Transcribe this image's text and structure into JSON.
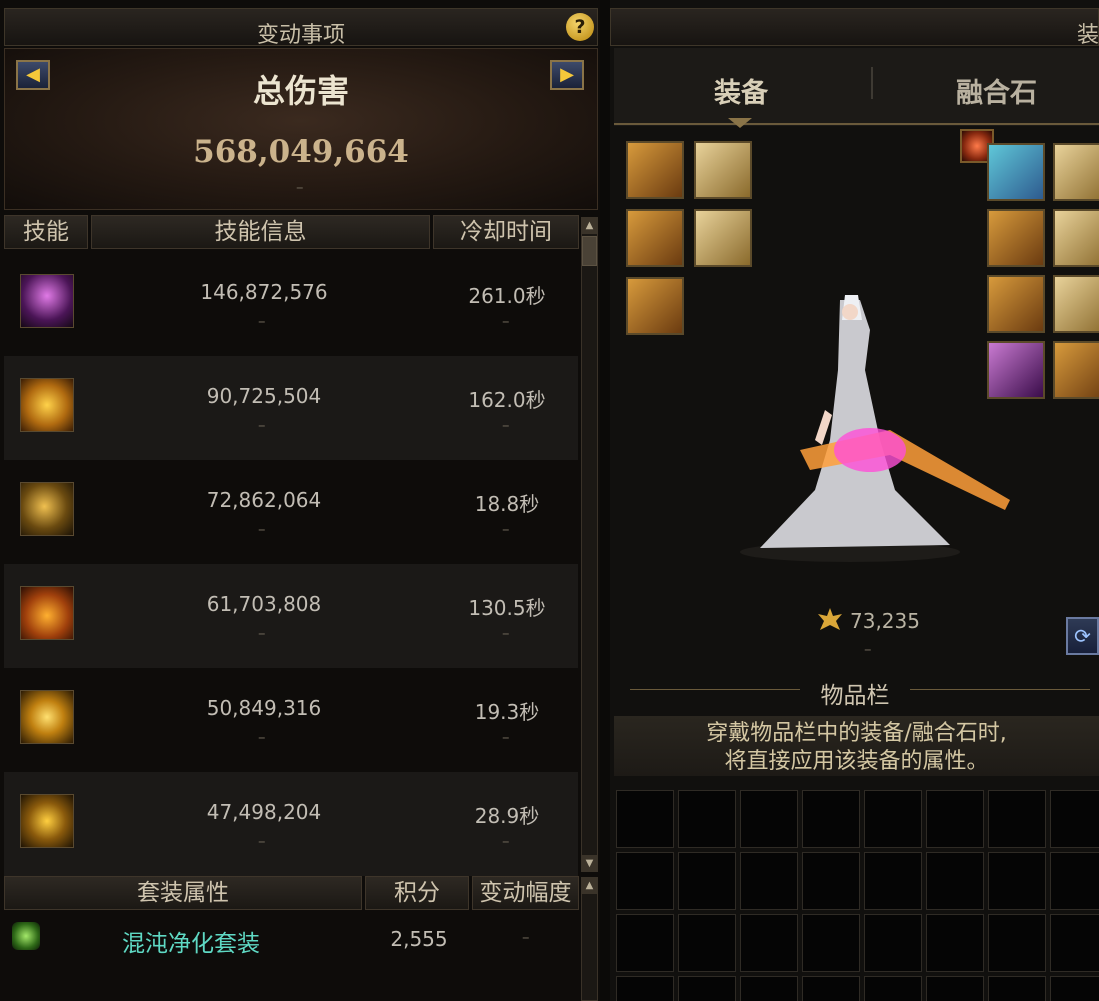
{
  "left_panel": {
    "title": "变动事项",
    "help_symbol": "?",
    "damage": {
      "prev_arrow": "◀",
      "next_arrow": "▶",
      "title": "总伤害",
      "value": "568,049,664",
      "change": "–"
    },
    "skills_table": {
      "headers": {
        "skill": "技能",
        "info": "技能信息",
        "cooldown": "冷却时间"
      },
      "rows": [
        {
          "icon": "skill-icon-1",
          "damage": "146,872,576",
          "damage_change": "–",
          "cooldown": "261.0秒",
          "cooldown_change": "–"
        },
        {
          "icon": "skill-icon-2",
          "damage": "90,725,504",
          "damage_change": "–",
          "cooldown": "162.0秒",
          "cooldown_change": "–"
        },
        {
          "icon": "skill-icon-3",
          "damage": "72,862,064",
          "damage_change": "–",
          "cooldown": "18.8秒",
          "cooldown_change": "–"
        },
        {
          "icon": "skill-icon-4",
          "damage": "61,703,808",
          "damage_change": "–",
          "cooldown": "130.5秒",
          "cooldown_change": "–"
        },
        {
          "icon": "skill-icon-5",
          "damage": "50,849,316",
          "damage_change": "–",
          "cooldown": "19.3秒",
          "cooldown_change": "–"
        },
        {
          "icon": "skill-icon-6",
          "damage": "47,498,204",
          "damage_change": "–",
          "cooldown": "28.9秒",
          "cooldown_change": "–"
        }
      ]
    },
    "set_table": {
      "headers": {
        "set": "套装属性",
        "score": "积分",
        "change": "变动幅度"
      },
      "rows": [
        {
          "icon": "set-icon",
          "name": "混沌净化套装",
          "score": "2,555",
          "change": "–"
        }
      ]
    },
    "scroll_up": "▲",
    "scroll_down": "▼"
  },
  "right_panel": {
    "title": "装",
    "tabs": {
      "equipment": "装备",
      "fusion_stone": "融合石"
    },
    "score": "73,235",
    "score_change": "–",
    "refresh_symbol": "⟳",
    "inventory": {
      "title": "物品栏",
      "notice_line1": "穿戴物品栏中的装备/融合石时,",
      "notice_line2": "将直接应用该装备的属性。"
    }
  },
  "colors": {
    "accent_gold": "#cbb38c",
    "set_name_green": "#5fd9c4",
    "tab_underline": "#8a7448"
  }
}
